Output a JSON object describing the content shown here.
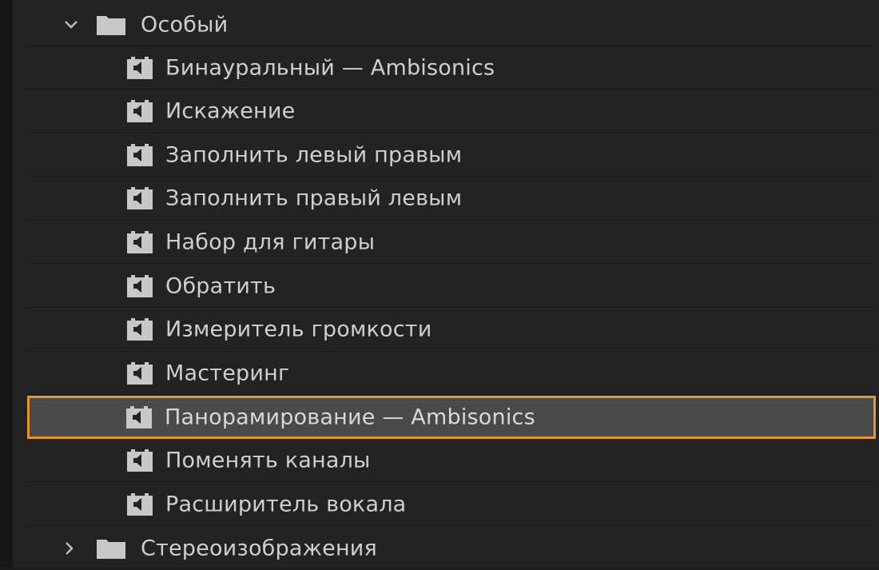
{
  "tree": {
    "folder_open": {
      "label": "Особый",
      "icon": "folder-icon",
      "chevron": "chevron-down-icon"
    },
    "items": [
      {
        "label": "Бинауральный — Ambisonics"
      },
      {
        "label": "Искажение"
      },
      {
        "label": "Заполнить левый правым"
      },
      {
        "label": "Заполнить правый левым"
      },
      {
        "label": "Набор для гитары"
      },
      {
        "label": "Обратить"
      },
      {
        "label": "Измеритель громкости"
      },
      {
        "label": "Мастеринг"
      },
      {
        "label": "Панорамирование — Ambisonics",
        "selected": true
      },
      {
        "label": "Поменять каналы"
      },
      {
        "label": "Расширитель вокала"
      }
    ],
    "folder_closed": {
      "label": "Стереоизображения",
      "icon": "folder-icon",
      "chevron": "chevron-right-icon"
    }
  },
  "colors": {
    "background": "#232323",
    "text": "#cfcfcf",
    "icon": "#c8c8c8",
    "selection_border": "#e8962a",
    "selection_fill": "#4a4a4a"
  }
}
